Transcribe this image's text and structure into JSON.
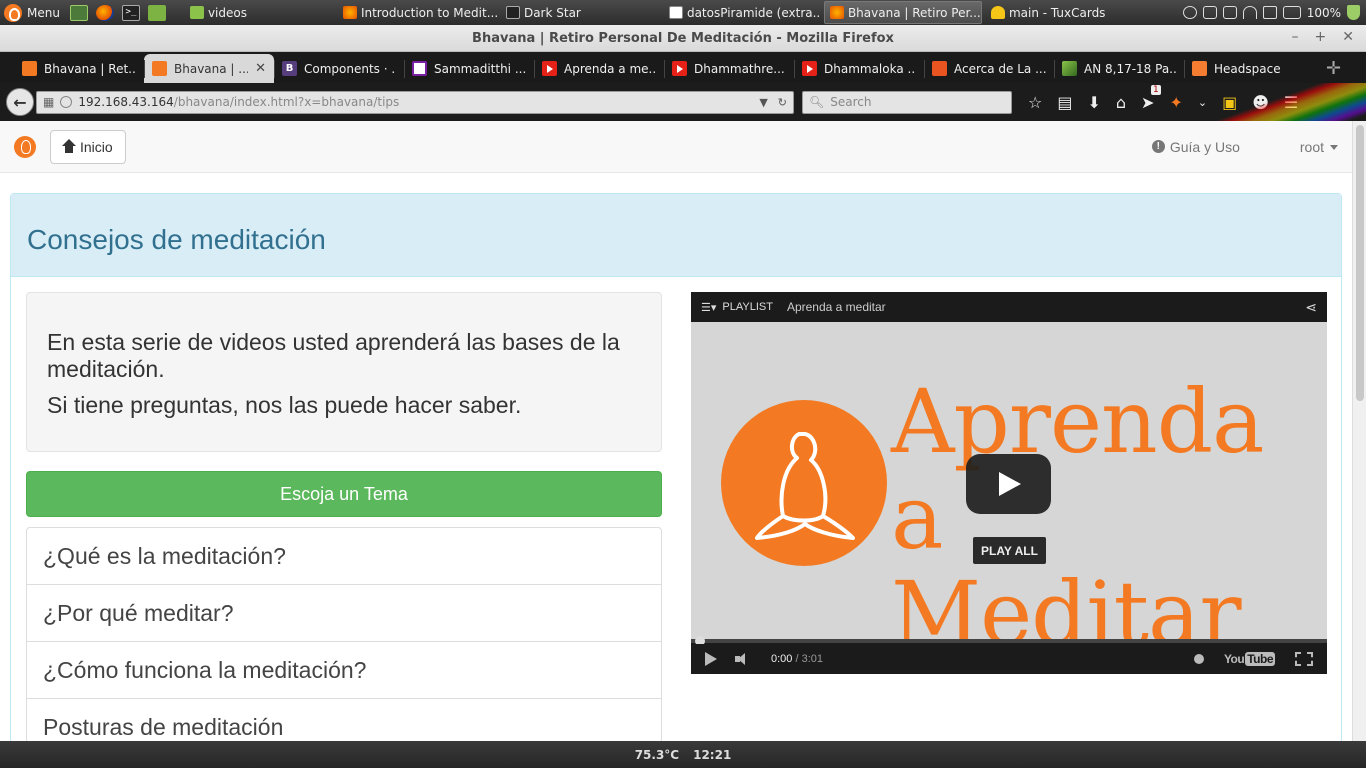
{
  "taskbar": {
    "menu_label": "Menu",
    "tasks": [
      {
        "label": "videos"
      },
      {
        "label": "Introduction to Medit..."
      },
      {
        "label": "Dark Star"
      },
      {
        "label": "datosPiramide (extra..."
      },
      {
        "label": "Bhavana | Retiro Per..."
      },
      {
        "label": "main - TuxCards"
      }
    ],
    "battery": "100%"
  },
  "window": {
    "title": "Bhavana | Retiro Personal De Meditación - Mozilla Firefox"
  },
  "tabs": [
    {
      "label": "Bhavana | Ret..."
    },
    {
      "label": "Bhavana | ..."
    },
    {
      "label": "Components · ..."
    },
    {
      "label": "Sammaditthi ..."
    },
    {
      "label": "Aprenda a me..."
    },
    {
      "label": "Dhammathre..."
    },
    {
      "label": "Dhammaloka ..."
    },
    {
      "label": "Acerca de La ..."
    },
    {
      "label": "AN 8,17-18 Pa..."
    },
    {
      "label": "Headspace"
    }
  ],
  "navbar": {
    "url_host": "192.168.43.164",
    "url_path": "/bhavana/index.html?x=bhavana/tips",
    "search_placeholder": "Search",
    "badge_count": "1"
  },
  "site": {
    "home_label": "Inicio",
    "help_label": "Guía y Uso",
    "user_label": "root"
  },
  "panel": {
    "title": "Consejos de meditación",
    "intro": [
      "En esta serie de videos usted aprenderá las bases de la meditación.",
      "Si tiene preguntas, nos las puede hacer saber."
    ],
    "choose_label": "Escoja un Tema",
    "topics": [
      "¿Qué es la meditación?",
      "¿Por qué meditar?",
      "¿Cómo funciona la meditación?",
      "Posturas de meditación"
    ]
  },
  "video": {
    "playlist_label": "PLAYLIST",
    "title": "Aprenda a meditar",
    "thumbnail_text_1": "Aprenda a",
    "thumbnail_text_2": "Meditar",
    "play_all_label": "PLAY ALL",
    "current_time": "0:00",
    "duration": "/ 3:01",
    "youtube_label": "You",
    "youtube_tube": "Tube",
    "progress_fraction": 0
  },
  "statusbar": {
    "temperature": "75.3°C",
    "clock": "12:21"
  },
  "colors": {
    "brand_orange": "#f37a22",
    "success_green": "#5cb85c",
    "info_heading_bg": "#d9edf7",
    "info_heading_text": "#31708f"
  }
}
